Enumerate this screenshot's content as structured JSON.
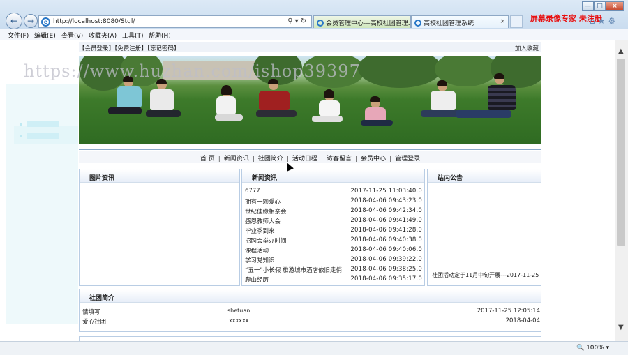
{
  "browser": {
    "url": "http://localhost:8080/Stgl/",
    "tabs": [
      {
        "label": "会员管理中心---高校社团管理..."
      },
      {
        "label": "高校社团管理系统"
      }
    ],
    "recorder_watermark": "屏幕录像专家 未注册",
    "menu": [
      "文件(F)",
      "编辑(E)",
      "查看(V)",
      "收藏夹(A)",
      "工具(T)",
      "帮助(H)"
    ],
    "zoom": "100%"
  },
  "page": {
    "watermark": "https://www.huzhan.com/ishop39397",
    "top_links": "【会员登录】【免费注册】【忘记密码】",
    "favorite": "加入收藏",
    "nav": [
      "首 页",
      "新闻资讯",
      "社团简介",
      "活动日程",
      "访客留言",
      "会员中心",
      "管理登录"
    ],
    "panels": {
      "images_title": "图片资讯",
      "news_title": "新闻资讯",
      "notice_title": "站内公告",
      "club_title": "社团简介"
    },
    "news": [
      {
        "title": "6777",
        "date": "2017-11-25 11:03:40.0"
      },
      {
        "title": "拥有一颗爱心",
        "date": "2018-04-06 09:43:23.0"
      },
      {
        "title": "世纪佳缘相亲会",
        "date": "2018-04-06 09:42:34.0"
      },
      {
        "title": "感恩教师大会",
        "date": "2018-04-06 09:41:49.0"
      },
      {
        "title": "毕业季到来",
        "date": "2018-04-06 09:41:28.0"
      },
      {
        "title": "招聘会举办时间",
        "date": "2018-04-06 09:40:38.0"
      },
      {
        "title": "课程活动",
        "date": "2018-04-06 09:40:06.0"
      },
      {
        "title": "学习党知识",
        "date": "2018-04-06 09:39:22.0"
      },
      {
        "title": "“五一”小长假 旅游城市酒店依旧走俏",
        "date": "2018-04-06 09:38:25.0"
      },
      {
        "title": "爬山经历",
        "date": "2018-04-06 09:35:17.0"
      }
    ],
    "notice": "社团活动定于11月中旬开展---2017-11-25",
    "clubs": [
      {
        "name": "请填写",
        "code": "shetuan",
        "date": "2017-11-25 12:05:14"
      },
      {
        "name": "爱心社团",
        "code": "xxxxxx",
        "date": "2018-04-04"
      }
    ]
  }
}
